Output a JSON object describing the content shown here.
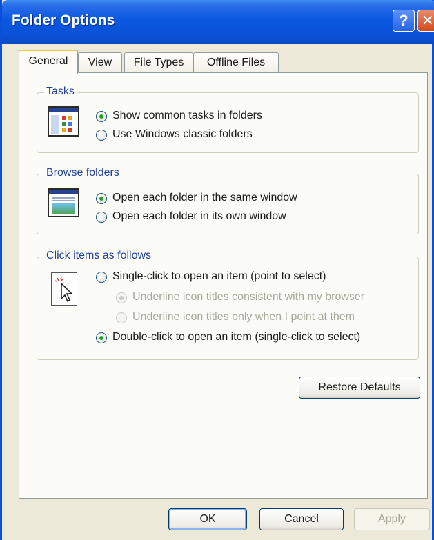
{
  "window": {
    "title": "Folder Options",
    "help_glyph": "?",
    "close_glyph": "✕"
  },
  "tabs": [
    {
      "label": "General",
      "active": true
    },
    {
      "label": "View",
      "active": false
    },
    {
      "label": "File Types",
      "active": false
    },
    {
      "label": "Offline Files",
      "active": false
    }
  ],
  "groups": {
    "tasks": {
      "label": "Tasks",
      "icon": "tasks-folder-icon",
      "options": [
        {
          "label": "Show common tasks in folders",
          "selected": true,
          "enabled": true
        },
        {
          "label": "Use Windows classic folders",
          "selected": false,
          "enabled": true
        }
      ]
    },
    "browse": {
      "label": "Browse folders",
      "icon": "browse-window-icon",
      "options": [
        {
          "label": "Open each folder in the same window",
          "selected": true,
          "enabled": true
        },
        {
          "label": "Open each folder in its own window",
          "selected": false,
          "enabled": true
        }
      ]
    },
    "click": {
      "label": "Click items as follows",
      "icon": "click-cursor-icon",
      "options": [
        {
          "label": "Single-click to open an item (point to select)",
          "selected": false,
          "enabled": true
        },
        {
          "label": "Underline icon titles consistent with my browser",
          "selected": true,
          "enabled": false
        },
        {
          "label": "Underline icon titles only when I point at them",
          "selected": false,
          "enabled": false
        },
        {
          "label": "Double-click to open an item (single-click to select)",
          "selected": true,
          "enabled": true
        }
      ]
    }
  },
  "buttons": {
    "restore": "Restore Defaults",
    "ok": "OK",
    "cancel": "Cancel",
    "apply": "Apply"
  },
  "colors": {
    "title_bar": "#0a58e0",
    "radio_dot": "#21a121",
    "group_label": "#1f3f9a"
  }
}
